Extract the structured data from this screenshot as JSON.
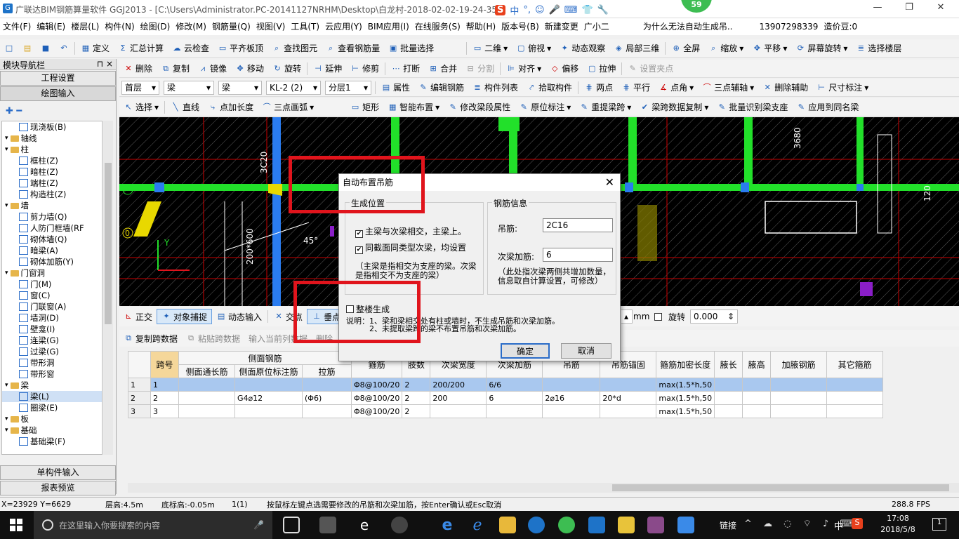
{
  "window": {
    "title": "广联达BIM钢筋算量软件 GGJ2013 - [C:\\Users\\Administrator.PC-20141127NRHM\\Desktop\\白龙村-2018-02-02-19-24-35",
    "badge": "59",
    "ime": [
      "中",
      "°,",
      "☺",
      "🎤",
      "⌨",
      "👕",
      "🔧"
    ]
  },
  "menu": [
    "文件(F)",
    "编辑(E)",
    "楼层(L)",
    "构件(N)",
    "绘图(D)",
    "修改(M)",
    "钢筋量(Q)",
    "视图(V)",
    "工具(T)",
    "云应用(Y)",
    "BIM应用(I)",
    "在线服务(S)",
    "帮助(H)",
    "版本号(B)",
    "新建变更",
    "广小二",
    "为什么无法自动生成吊..",
    "13907298339",
    "造价豆:0"
  ],
  "toolbar1": [
    "定义",
    "汇总计算",
    "云检查",
    "平齐板顶",
    "查找图元",
    "查看钢筋量",
    "批量选择",
    "二维",
    "俯视",
    "动态观察",
    "局部三维",
    "全屏",
    "缩放",
    "平移",
    "屏幕旋转",
    "选择楼层"
  ],
  "toolbar2": [
    "删除",
    "复制",
    "镜像",
    "移动",
    "旋转",
    "延伸",
    "修剪",
    "打断",
    "合并",
    "分割",
    "对齐",
    "偏移",
    "拉伸",
    "设置夹点"
  ],
  "toolbar3": {
    "combos": [
      "首层",
      "梁",
      "梁",
      "KL-2 (2)",
      "分层1"
    ],
    "items": [
      "属性",
      "编辑钢筋",
      "构件列表",
      "拾取构件",
      "两点",
      "平行",
      "点角",
      "三点辅轴",
      "删除辅助",
      "尺寸标注"
    ]
  },
  "toolbar4": [
    "选择",
    "直线",
    "点加长度",
    "三点画弧",
    "矩形",
    "智能布置",
    "修改梁段属性",
    "原位标注",
    "重提梁跨",
    "梁跨数据复制",
    "批量识别梁支座",
    "应用到同名梁"
  ],
  "nav": {
    "title": "模块导航栏",
    "pin": "⊓ ×",
    "top_buttons": [
      "工程设置",
      "绘图输入"
    ],
    "tree": [
      {
        "label": "现浇板(B)",
        "level": 2
      },
      {
        "label": "轴线",
        "level": 0
      },
      {
        "label": "柱",
        "level": 0
      },
      {
        "label": "框柱(Z)",
        "level": 1
      },
      {
        "label": "暗柱(Z)",
        "level": 1
      },
      {
        "label": "端柱(Z)",
        "level": 1
      },
      {
        "label": "构造柱(Z)",
        "level": 1
      },
      {
        "label": "墙",
        "level": 0
      },
      {
        "label": "剪力墙(Q)",
        "level": 1
      },
      {
        "label": "人防门框墙(RF",
        "level": 1
      },
      {
        "label": "砌体墙(Q)",
        "level": 1
      },
      {
        "label": "暗梁(A)",
        "level": 1
      },
      {
        "label": "砌体加筋(Y)",
        "level": 1
      },
      {
        "label": "门窗洞",
        "level": 0
      },
      {
        "label": "门(M)",
        "level": 1
      },
      {
        "label": "窗(C)",
        "level": 1
      },
      {
        "label": "门联窗(A)",
        "level": 1
      },
      {
        "label": "墙洞(D)",
        "level": 1
      },
      {
        "label": "壁龛(I)",
        "level": 1
      },
      {
        "label": "连梁(G)",
        "level": 1
      },
      {
        "label": "过梁(G)",
        "level": 1
      },
      {
        "label": "带形洞",
        "level": 1
      },
      {
        "label": "带形窗",
        "level": 1
      },
      {
        "label": "梁",
        "level": 0
      },
      {
        "label": "梁(L)",
        "level": 1
      },
      {
        "label": "圈梁(E)",
        "level": 1
      },
      {
        "label": "板",
        "level": 0
      },
      {
        "label": "基础",
        "level": 0
      },
      {
        "label": "基础梁(F)",
        "level": 1
      }
    ],
    "bottom_buttons": [
      "单构件输入",
      "报表预览"
    ]
  },
  "canvas": {
    "labels": [
      "3C20",
      "200*600",
      "45°",
      "3680",
      "120",
      "Y",
      "0"
    ]
  },
  "dialog": {
    "title": "自动布置吊筋",
    "section_position": "生成位置",
    "opt1": "主梁与次梁相交，主梁上。",
    "opt2": "同截面同类型次梁，均设置",
    "note": "（主梁是指相交为支座的梁。次梁是指相交不为支座的梁）",
    "section_rebar": "钢筋信息",
    "hanging_label": "吊筋:",
    "hanging_value": "2C16",
    "secondary_label": "次梁加筋:",
    "secondary_value": "6",
    "rebar_note": "（此处指次梁两侧共增加数量，信息取自计算设置，可修改）",
    "whole": "整楼生成",
    "desc": "说明：1、梁和梁相交处有柱或墙时，不生成吊筋和次梁加筋。\n　　　2、未提取梁跨的梁不布置吊筋和次梁加筋。",
    "ok": "确定",
    "cancel": "取消"
  },
  "bottom_toolbar": [
    "正交",
    "对象捕捉",
    "动态输入",
    "交点",
    "垂点",
    "mm",
    "旋转",
    "0.000"
  ],
  "span_toolbar": [
    "复制跨数据",
    "粘贴跨数据",
    "输入当前列数据",
    "删除"
  ],
  "table": {
    "headers_top": [
      "跨号",
      "侧面钢筋",
      "箍筋",
      "肢数",
      "次梁宽度",
      "次梁加筋",
      "吊筋",
      "吊筋锚固",
      "箍筋加密长度",
      "腋长",
      "腋高",
      "加腋钢筋",
      "其它箍筋"
    ],
    "headers_sub": [
      "侧面通长筋",
      "侧面原位标注筋",
      "拉筋"
    ],
    "rows": [
      [
        "1",
        "",
        "",
        "",
        "Φ8@100/20",
        "2",
        "200/200",
        "6/6",
        "",
        "",
        "max(1.5*h,50",
        "",
        "",
        "",
        ""
      ],
      [
        "2",
        "",
        "G4⌀12",
        "(Φ6)",
        "Φ8@100/20",
        "2",
        "200",
        "6",
        "2⌀16",
        "20*d",
        "max(1.5*h,50",
        "",
        "",
        "",
        ""
      ],
      [
        "3",
        "",
        "",
        "",
        "Φ8@100/20",
        "2",
        "",
        "",
        "",
        "",
        "max(1.5*h,50",
        "",
        "",
        "",
        ""
      ]
    ],
    "row_index": [
      "1",
      "2",
      "3"
    ]
  },
  "status": {
    "coords": "X=23929 Y=6629",
    "floor_height": "层高:4.5m",
    "base_height": "底标高:-0.05m",
    "count": "1(1)",
    "hint": "按鼠标左键点选需要修改的吊筋和次梁加筋，按Enter确认或Esc取消",
    "fps": "288.8 FPS"
  },
  "taskbar": {
    "search": "在这里输入你要搜索的内容",
    "link": "链接",
    "lang": "中",
    "time": "17:08",
    "date": "2018/5/8",
    "notif": "1"
  }
}
